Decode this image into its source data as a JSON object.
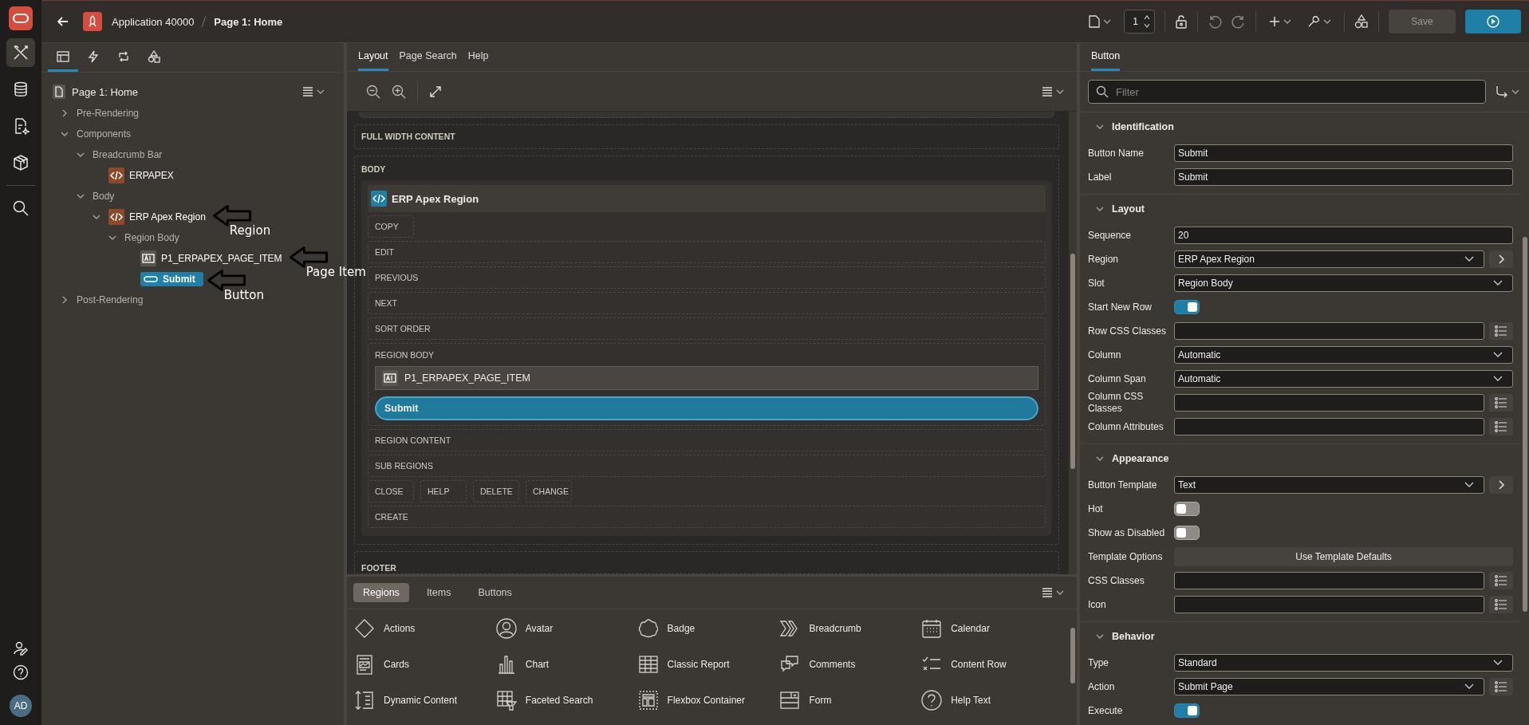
{
  "header": {
    "app_name": "Application 40000",
    "page_name": "Page 1: Home",
    "page_number": "1",
    "save": {
      "label": "Save",
      "disabled": true
    }
  },
  "nav_rail": {
    "items": [
      {
        "kind": "tools",
        "selected": true
      },
      {
        "kind": "database",
        "selected": false
      },
      {
        "kind": "document",
        "selected": false
      },
      {
        "kind": "cube",
        "selected": false
      },
      {
        "kind": "search",
        "selected": false
      }
    ],
    "avatar": "AD"
  },
  "left_panel": {
    "tabs": [
      {
        "kind": "rendering",
        "selected": true
      },
      {
        "kind": "lightning",
        "selected": false
      },
      {
        "kind": "loop",
        "selected": false
      },
      {
        "kind": "shapes",
        "selected": false
      }
    ],
    "tree": {
      "label": "Page 1: Home",
      "children": [
        {
          "label": "Pre-Rendering",
          "kind": "group",
          "expanded": false,
          "selected": false
        },
        {
          "label": "Components",
          "kind": "group",
          "expanded": true,
          "selected": false,
          "children": [
            {
              "label": "Breadcrumb Bar",
              "kind": "group",
              "expanded": true,
              "selected": false,
              "children": [
                {
                  "label": "ERPAPEX",
                  "kind": "region",
                  "selected": false
                }
              ]
            },
            {
              "label": "Body",
              "kind": "group",
              "expanded": true,
              "selected": false,
              "children": [
                {
                  "label": "ERP Apex Region",
                  "kind": "region",
                  "expanded": true,
                  "selected": false,
                  "annotation": "Region",
                  "children": [
                    {
                      "label": "Region Body",
                      "kind": "group",
                      "expanded": true,
                      "selected": false,
                      "children": [
                        {
                          "label": "P1_ERPAPEX_PAGE_ITEM",
                          "kind": "item",
                          "selected": false,
                          "annotation": "Page Item"
                        },
                        {
                          "label": "Submit",
                          "kind": "button",
                          "selected": true,
                          "annotation": "Button"
                        }
                      ]
                    }
                  ]
                }
              ]
            }
          ]
        },
        {
          "label": "Post-Rendering",
          "kind": "group",
          "expanded": false,
          "selected": false
        }
      ]
    }
  },
  "center": {
    "tabs": [
      {
        "label": "Layout",
        "selected": true
      },
      {
        "label": "Page Search",
        "selected": false
      },
      {
        "label": "Help",
        "selected": false
      }
    ],
    "canvas": {
      "full_width_label": "FULL WIDTH CONTENT",
      "body_label": "BODY",
      "footer_label": "FOOTER",
      "region": {
        "title": "ERP Apex Region",
        "slots": [
          {
            "kind": "small",
            "labels": [
              "COPY"
            ]
          },
          {
            "kind": "wide",
            "label": "EDIT"
          },
          {
            "kind": "wide",
            "label": "PREVIOUS"
          },
          {
            "kind": "wide",
            "label": "NEXT"
          },
          {
            "kind": "wide",
            "label": "SORT ORDER"
          },
          {
            "kind": "body",
            "label": "REGION BODY",
            "item": "P1_ERPAPEX_PAGE_ITEM",
            "button": "Submit"
          },
          {
            "kind": "wide",
            "label": "REGION CONTENT"
          },
          {
            "kind": "wide",
            "label": "SUB REGIONS"
          },
          {
            "kind": "small",
            "labels": [
              "CLOSE",
              "HELP",
              "DELETE",
              "CHANGE"
            ]
          },
          {
            "kind": "wide",
            "label": "CREATE"
          }
        ]
      }
    },
    "gallery": {
      "tabs": [
        {
          "label": "Regions",
          "selected": true
        },
        {
          "label": "Items",
          "selected": false
        },
        {
          "label": "Buttons",
          "selected": false
        }
      ],
      "items": [
        {
          "label": "Actions",
          "kind": "diamond"
        },
        {
          "label": "Avatar",
          "kind": "avatar"
        },
        {
          "label": "Badge",
          "kind": "badge"
        },
        {
          "label": "Breadcrumb",
          "kind": "chevrons"
        },
        {
          "label": "Calendar",
          "kind": "calendar"
        },
        {
          "label": "Cards",
          "kind": "card"
        },
        {
          "label": "Chart",
          "kind": "chart"
        },
        {
          "label": "Classic Report",
          "kind": "table"
        },
        {
          "label": "Comments",
          "kind": "comments"
        },
        {
          "label": "Content Row",
          "kind": "checklist"
        },
        {
          "label": "Dynamic Content",
          "kind": "dynamic"
        },
        {
          "label": "Faceted Search",
          "kind": "filter"
        },
        {
          "label": "Flexbox Container",
          "kind": "flexbox"
        },
        {
          "label": "Form",
          "kind": "form"
        },
        {
          "label": "Help Text",
          "kind": "help"
        }
      ]
    }
  },
  "properties": {
    "tabs": [
      {
        "label": "Button",
        "selected": true
      }
    ],
    "filter_placeholder": "Filter",
    "groups": [
      {
        "title": "Identification",
        "expanded": true,
        "props": [
          {
            "label": "Button Name",
            "kind": "text",
            "value": "Submit"
          },
          {
            "label": "Label",
            "kind": "text",
            "value": "Submit"
          }
        ]
      },
      {
        "title": "Layout",
        "expanded": true,
        "props": [
          {
            "label": "Sequence",
            "kind": "text",
            "value": "20"
          },
          {
            "label": "Region",
            "kind": "select",
            "value": "ERP Apex Region",
            "go_to": true
          },
          {
            "label": "Slot",
            "kind": "select",
            "value": "Region Body"
          },
          {
            "label": "Start New Row",
            "kind": "switch",
            "on": true
          },
          {
            "label": "Row CSS Classes",
            "kind": "text",
            "picker": true
          },
          {
            "label": "Column",
            "kind": "select",
            "value": "Automatic"
          },
          {
            "label": "Column Span",
            "kind": "select",
            "value": "Automatic"
          },
          {
            "label": "Column CSS Classes",
            "kind": "text",
            "picker": true
          },
          {
            "label": "Column Attributes",
            "kind": "text",
            "picker": true
          }
        ]
      },
      {
        "title": "Appearance",
        "expanded": true,
        "props": [
          {
            "label": "Button Template",
            "kind": "select",
            "value": "Text",
            "go_to": true
          },
          {
            "label": "Hot",
            "kind": "switch",
            "on": false
          },
          {
            "label": "Show as Disabled",
            "kind": "switch",
            "on": false
          },
          {
            "label": "Template Options",
            "kind": "action",
            "value": "Use Template Defaults"
          },
          {
            "label": "CSS Classes",
            "kind": "text",
            "picker": true
          },
          {
            "label": "Icon",
            "kind": "text",
            "picker": true
          }
        ]
      },
      {
        "title": "Behavior",
        "expanded": true,
        "props": [
          {
            "label": "Type",
            "kind": "select",
            "value": "Standard"
          },
          {
            "label": "Action",
            "kind": "select",
            "value": "Submit Page",
            "picker": true
          },
          {
            "label": "Execute",
            "kind": "switch",
            "on": true
          }
        ]
      }
    ]
  }
}
